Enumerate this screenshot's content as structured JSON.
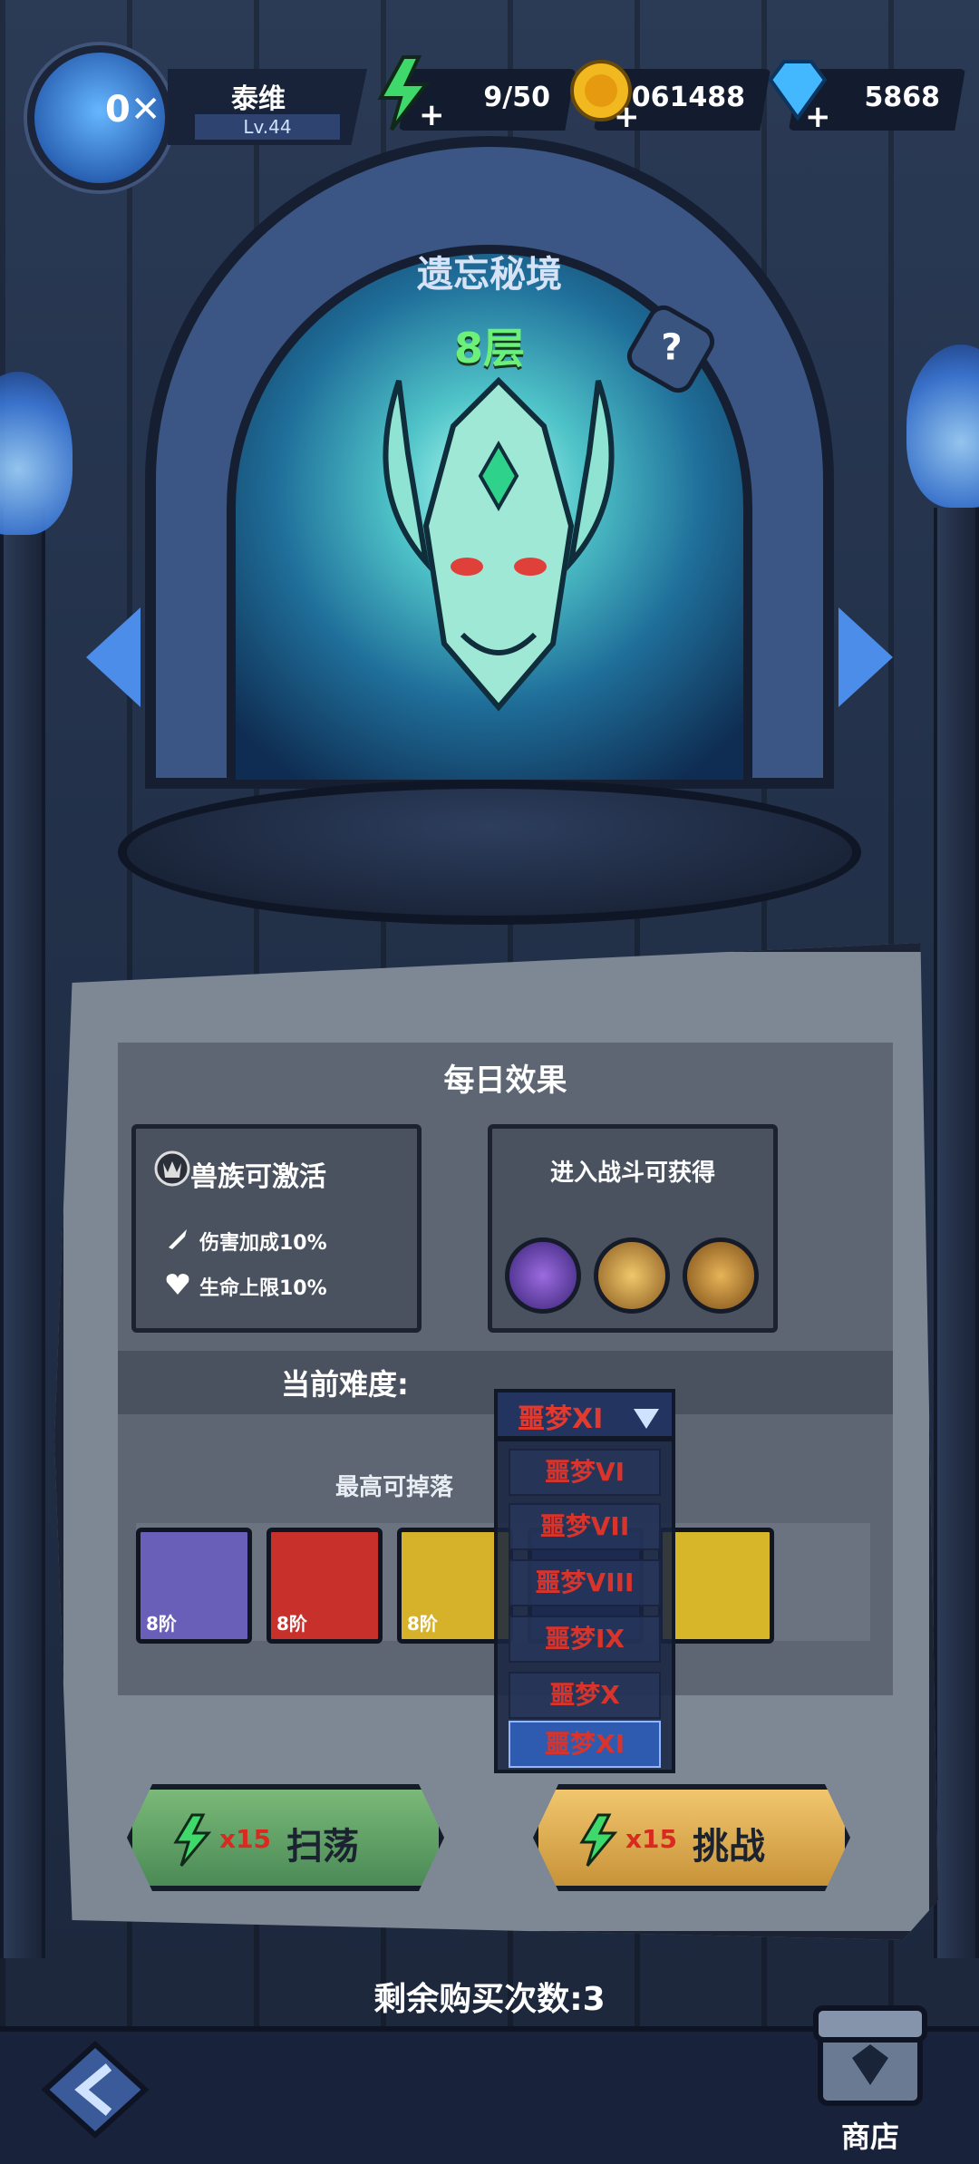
{
  "player": {
    "name": "泰维",
    "level": "Lv.44"
  },
  "resources": {
    "energy": "9/50",
    "coins": "5061488",
    "gems": "5868"
  },
  "stage": {
    "title": "遗忘秘境",
    "floor": "8层",
    "help": "?"
  },
  "daily": {
    "title": "每日效果",
    "buff_title": "兽族可激活",
    "buffs": [
      "伤害加成10%",
      "生命上限10%"
    ],
    "battle_reward_title": "进入战斗可获得"
  },
  "difficulty": {
    "label": "当前难度:",
    "selected": "噩梦XI",
    "options": [
      "噩梦VI",
      "噩梦VII",
      "噩梦VIII",
      "噩梦IX",
      "噩梦X",
      "噩梦XI"
    ],
    "max_drop_label": "最高可掉落"
  },
  "drops": [
    {
      "tier": "8阶",
      "color": "#6a5fb8"
    },
    {
      "tier": "8阶",
      "color": "#c8302b"
    },
    {
      "tier": "8阶",
      "color": "#d6b22a"
    },
    {
      "tier": "",
      "color": "#2e4aa0"
    },
    {
      "tier": "",
      "color": "#d8b62a"
    }
  ],
  "actions": {
    "sweep_cost": "x15",
    "sweep_label": "扫荡",
    "challenge_cost": "x15",
    "challenge_label": "挑战"
  },
  "remaining": "剩余购买次数:3",
  "shop": {
    "label": "商店"
  },
  "colors": {
    "energy": "#3fd86a",
    "floor": "#6cf07a",
    "difficulty": "#e33a2f"
  }
}
